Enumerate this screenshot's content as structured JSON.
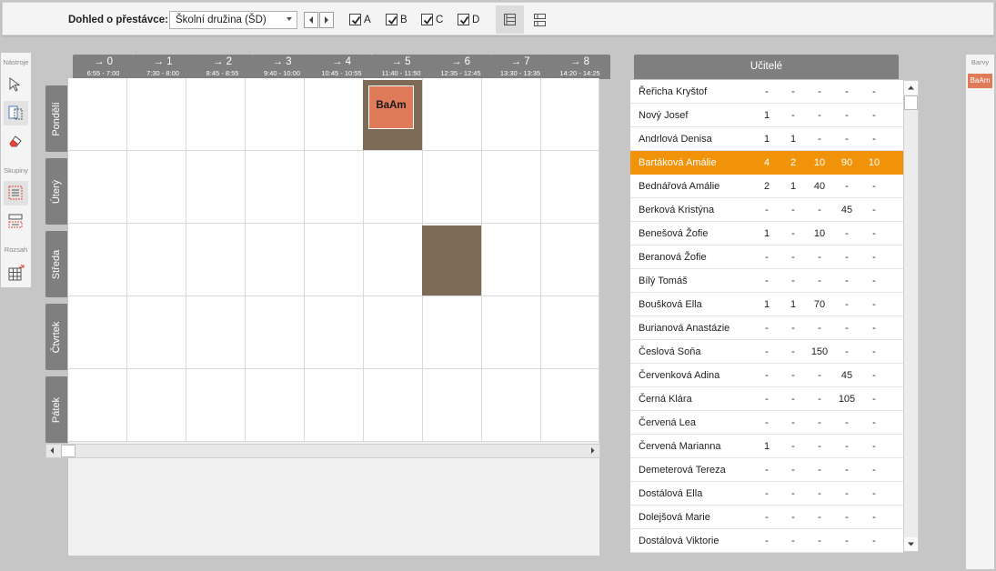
{
  "toolbar": {
    "supervision_label": "Dohled o přestávce:",
    "supervision_value": "Školní družina (ŠD)",
    "checkboxes": [
      {
        "label": "A",
        "checked": true
      },
      {
        "label": "B",
        "checked": true
      },
      {
        "label": "C",
        "checked": true
      },
      {
        "label": "D",
        "checked": true
      }
    ]
  },
  "palette": {
    "tools_header": "Nástroje",
    "groups_header": "Skupiny",
    "range_header": "Rozsah"
  },
  "periods": [
    {
      "number": "→ 0",
      "time": "6:55 - 7:00"
    },
    {
      "number": "→ 1",
      "time": "7:30 - 8:00"
    },
    {
      "number": "→ 2",
      "time": "8:45 - 8:55"
    },
    {
      "number": "→ 3",
      "time": "9:40 - 10:00"
    },
    {
      "number": "→ 4",
      "time": "10:45 - 10:55"
    },
    {
      "number": "→ 5",
      "time": "11:40 - 11:50"
    },
    {
      "number": "→ 6",
      "time": "12:35 - 12:45"
    },
    {
      "number": "→ 7",
      "time": "13:30 - 13:35"
    },
    {
      "number": "→ 8",
      "time": "14:20 - 14:25"
    }
  ],
  "days": [
    "Pondělí",
    "Úterý",
    "Středa",
    "Čtvrtek",
    "Pátek"
  ],
  "lessons": [
    {
      "day": 0,
      "period": 5,
      "card": "BaAm"
    },
    {
      "day": 2,
      "period": 6,
      "card": ""
    }
  ],
  "teachers_header": "Učitelé",
  "teachers": [
    {
      "name": "Řeřicha Kryštof",
      "values": [
        "-",
        "-",
        "-",
        "-",
        "-"
      ]
    },
    {
      "name": "Nový Josef",
      "values": [
        "1",
        "-",
        "-",
        "-",
        "-"
      ]
    },
    {
      "name": "Andrlová Denisa",
      "values": [
        "1",
        "1",
        "-",
        "-",
        "-"
      ]
    },
    {
      "name": "Bartáková Amálie",
      "values": [
        "4",
        "2",
        "10",
        "90",
        "10"
      ],
      "selected": true
    },
    {
      "name": "Bednářová Amálie",
      "values": [
        "2",
        "1",
        "40",
        "-",
        "-"
      ]
    },
    {
      "name": "Berková Kristýna",
      "values": [
        "-",
        "-",
        "-",
        "45",
        "-"
      ]
    },
    {
      "name": "Benešová Žofie",
      "values": [
        "1",
        "-",
        "10",
        "-",
        "-"
      ]
    },
    {
      "name": "Beranová Žofie",
      "values": [
        "-",
        "-",
        "-",
        "-",
        "-"
      ]
    },
    {
      "name": "Bílý Tomáš",
      "values": [
        "-",
        "-",
        "-",
        "-",
        "-"
      ]
    },
    {
      "name": "Boušková Ella",
      "values": [
        "1",
        "1",
        "70",
        "-",
        "-"
      ]
    },
    {
      "name": "Burianová Anastázie",
      "values": [
        "-",
        "-",
        "-",
        "-",
        "-"
      ]
    },
    {
      "name": "Česlová Soňa",
      "values": [
        "-",
        "-",
        "150",
        "-",
        "-"
      ]
    },
    {
      "name": "Červenková Adina",
      "values": [
        "-",
        "-",
        "-",
        "45",
        "-"
      ]
    },
    {
      "name": "Černá Klára",
      "values": [
        "-",
        "-",
        "-",
        "105",
        "-"
      ]
    },
    {
      "name": "Červená Lea",
      "values": [
        "-",
        "-",
        "-",
        "-",
        "-"
      ]
    },
    {
      "name": "Červená Marianna",
      "values": [
        "1",
        "-",
        "-",
        "-",
        "-"
      ]
    },
    {
      "name": "Demeterová Tereza",
      "values": [
        "-",
        "-",
        "-",
        "-",
        "-"
      ]
    },
    {
      "name": "Dostálová Ella",
      "values": [
        "-",
        "-",
        "-",
        "-",
        "-"
      ]
    },
    {
      "name": "Dolejšová Marie",
      "values": [
        "-",
        "-",
        "-",
        "-",
        "-"
      ]
    },
    {
      "name": "Dostálová Viktorie",
      "values": [
        "-",
        "-",
        "-",
        "-",
        "-"
      ]
    }
  ],
  "colors_panel": {
    "header": "Barvy",
    "chips": [
      {
        "label": "BaAm",
        "color": "#e07b5a"
      }
    ]
  },
  "theme": {
    "lesson_color": "#7e6b57",
    "card_color": "#e07b5a",
    "selected_row_color": "#f19308"
  }
}
